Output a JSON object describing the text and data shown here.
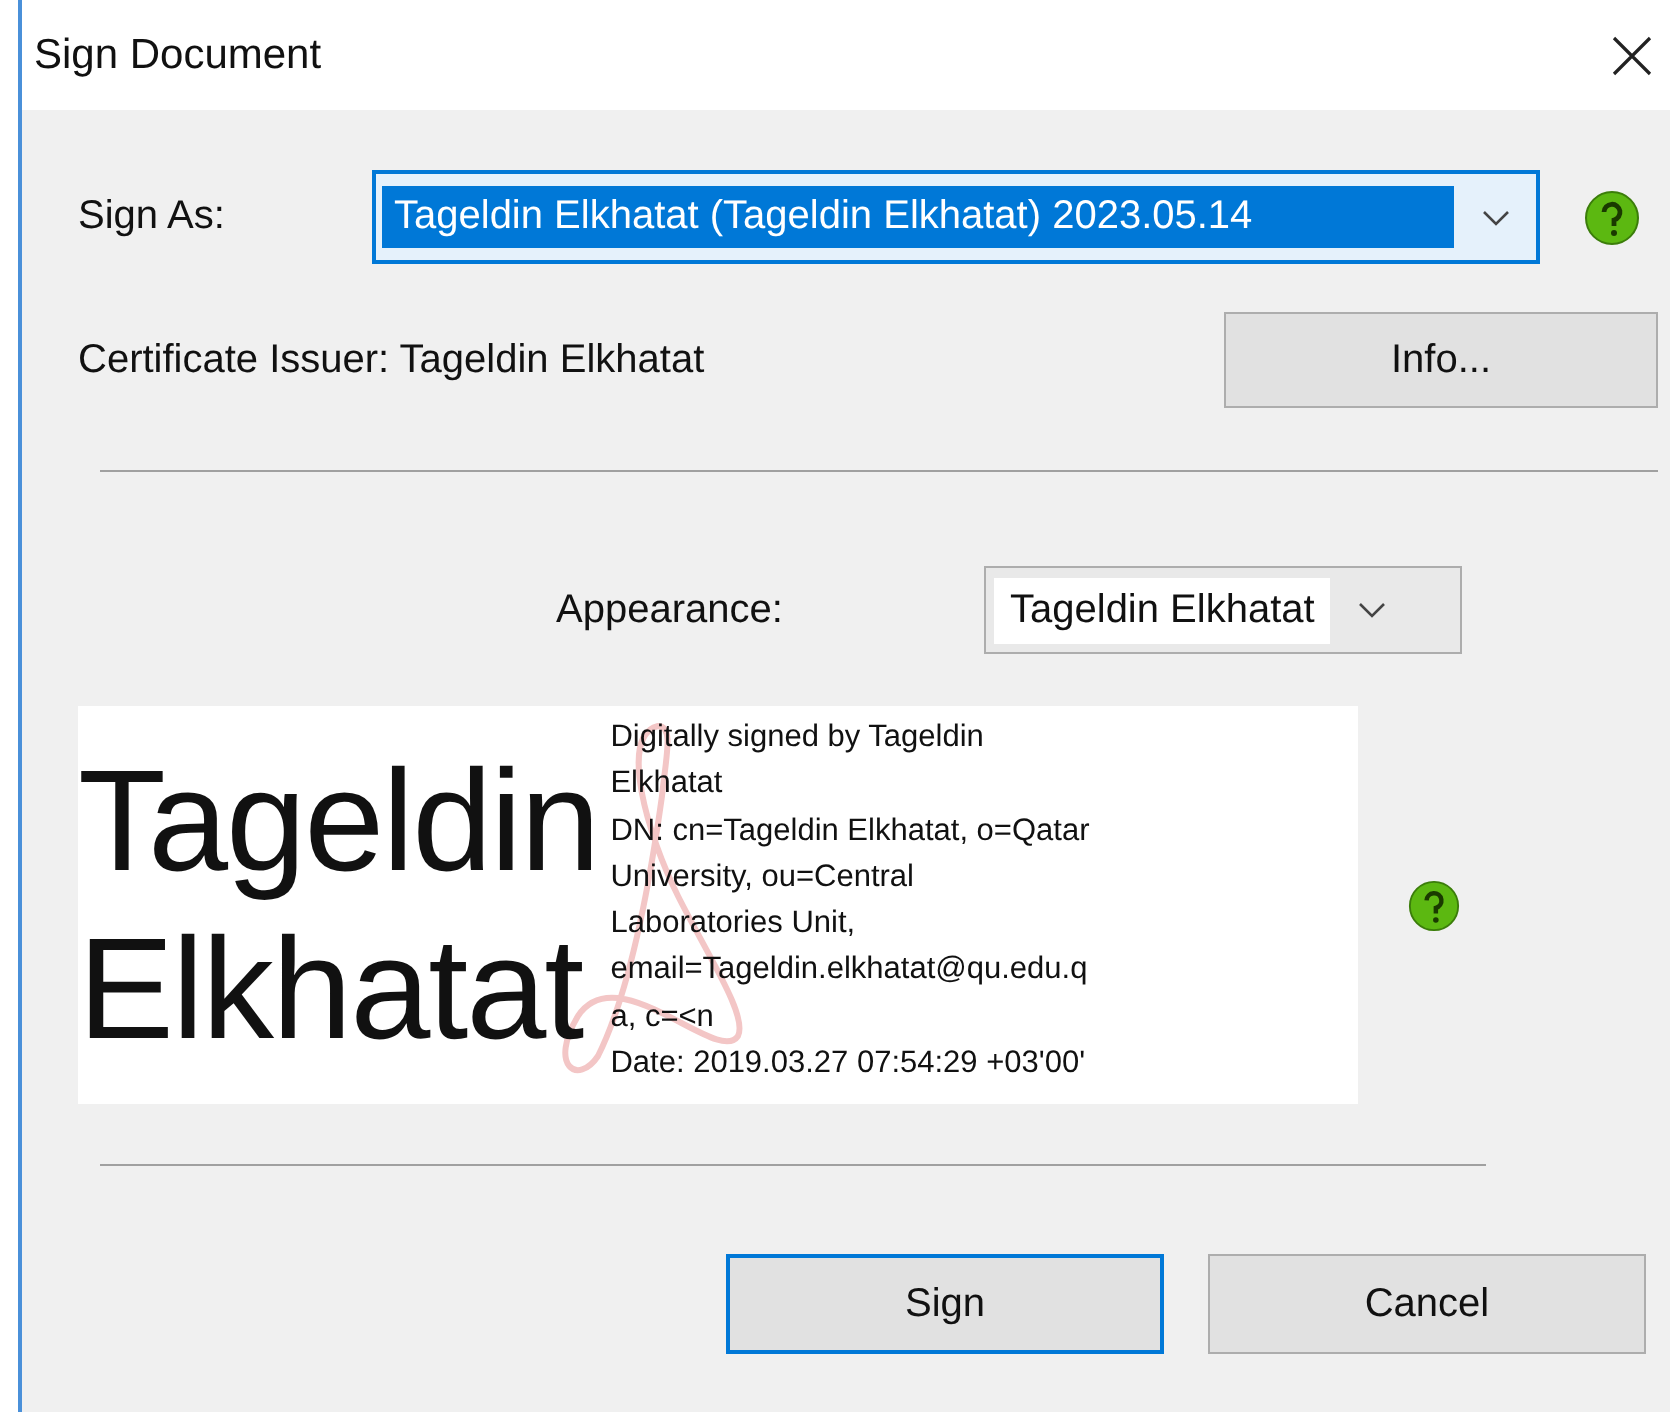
{
  "window": {
    "title": "Sign Document"
  },
  "sign_as": {
    "label": "Sign As:",
    "value": "Tageldin Elkhatat (Tageldin Elkhatat) 2023.05.14",
    "focused": true
  },
  "certificate_issuer": "Certificate Issuer: Tageldin Elkhatat",
  "info_button": "Info...",
  "appearance": {
    "label": "Appearance:",
    "value": "Tageldin Elkhatat"
  },
  "preview": {
    "name_lines": [
      "Tageldin",
      "Elkhatat"
    ],
    "details": [
      "Digitally signed by Tageldin",
      "Elkhatat",
      "DN: cn=Tageldin Elkhatat, o=Qatar",
      "University, ou=Central",
      "Laboratories Unit,",
      "email=Tageldin.elkhatat@qu.edu.q",
      "a, c=<n",
      "Date: 2019.03.27 07:54:29 +03'00'"
    ]
  },
  "buttons": [
    {
      "label": "Sign",
      "default": true
    },
    {
      "label": "Cancel",
      "default": false
    }
  ]
}
